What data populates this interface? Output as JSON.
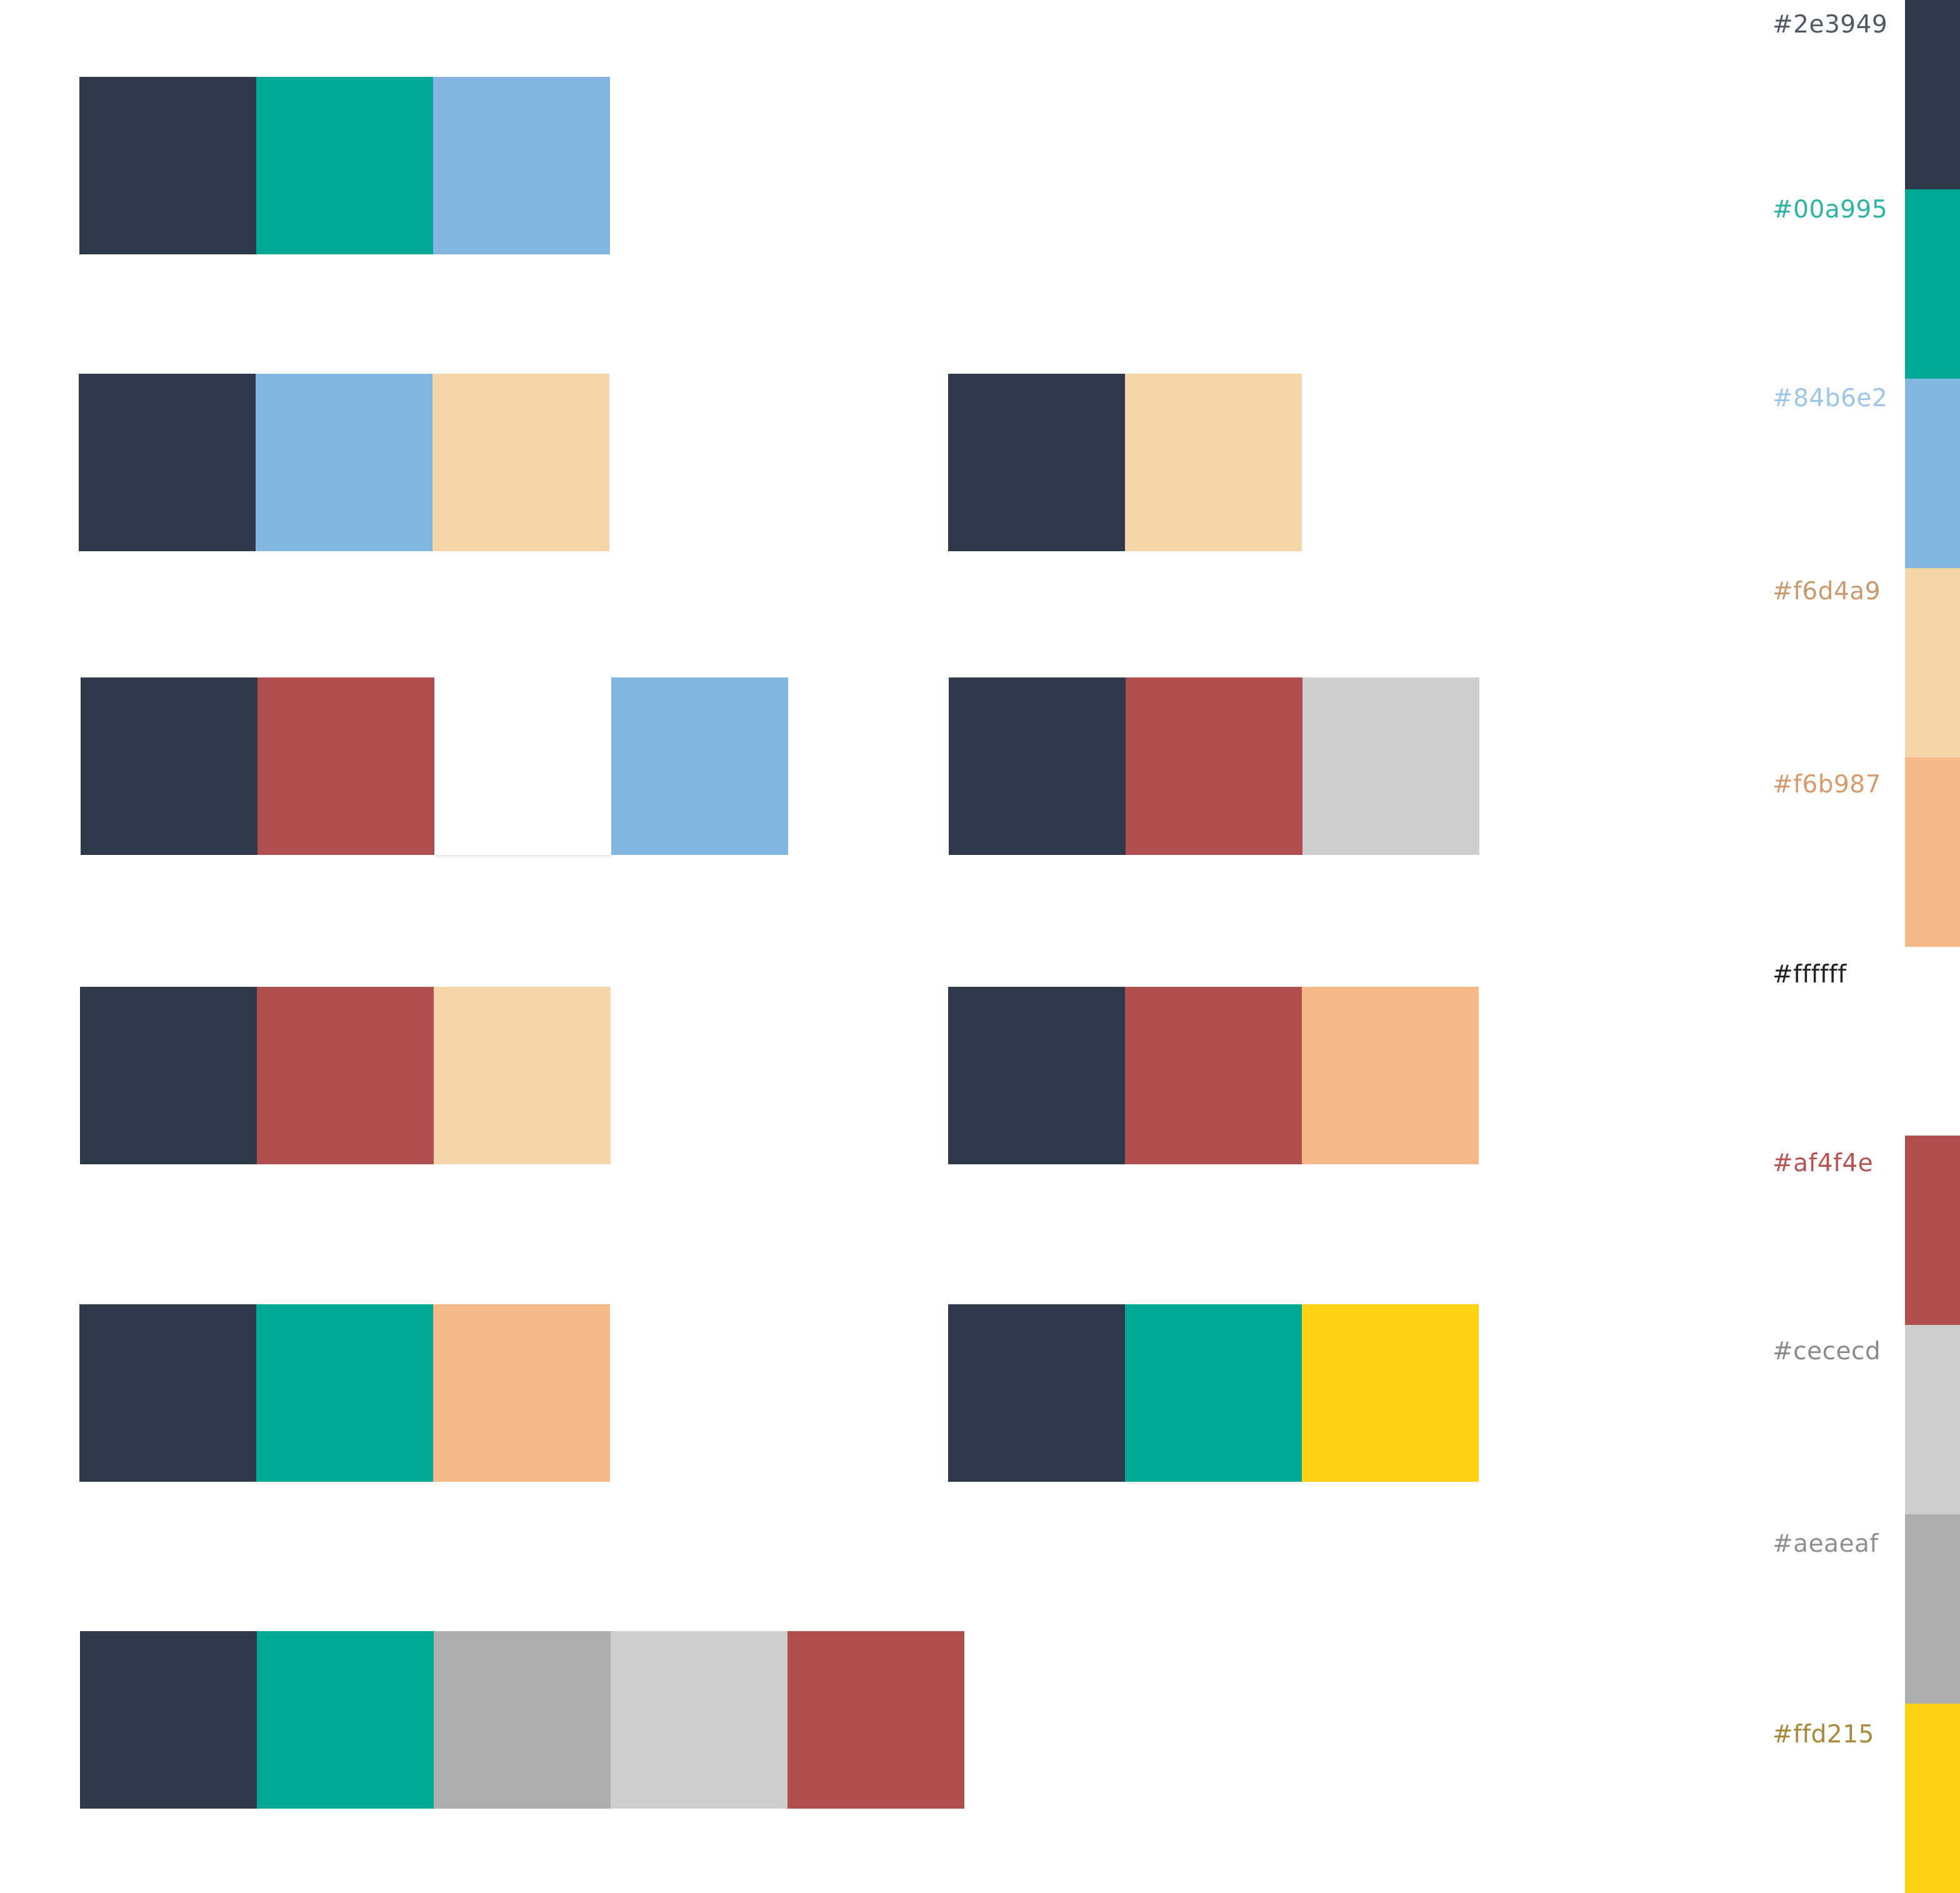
{
  "palette": [
    {
      "hex": "#2e3949",
      "label": "#2e3949",
      "label_color": "#505865"
    },
    {
      "hex": "#00a995",
      "label": "#00a995",
      "label_color": "#2db3a4"
    },
    {
      "hex": "#84b6e2",
      "label": "#84b6e2",
      "label_color": "#9cc5e8"
    },
    {
      "hex": "#f6d4a9",
      "label": "#f6d4a9",
      "label_color": "#c89b6e"
    },
    {
      "hex": "#f6b987",
      "label": "#f6b987",
      "label_color": "#d79b6b"
    },
    {
      "hex": "#ffffff",
      "label": "#ffffff",
      "label_color": "#222222"
    },
    {
      "hex": "#af4f4e",
      "label": "#af4f4e",
      "label_color": "#b65453"
    },
    {
      "hex": "#cececd",
      "label": "#cececd",
      "label_color": "#8a8a8a"
    },
    {
      "hex": "#aeaeaf",
      "label": "#aeaeaf",
      "label_color": "#8f8f90"
    },
    {
      "hex": "#ffd215",
      "label": "#ffd215",
      "label_color": "#a8893a"
    }
  ],
  "combinations": [
    {
      "colors": [
        "#2e3949",
        "#00a995",
        "#84b6e2"
      ]
    },
    {
      "colors": [
        "#2e3949",
        "#84b6e2",
        "#f6d4a9"
      ]
    },
    {
      "colors": [
        "#2e3949",
        "#f6d4a9"
      ]
    },
    {
      "colors": [
        "#2e3949",
        "#af4f4e",
        "#ffffff",
        "#84b6e2"
      ]
    },
    {
      "colors": [
        "#2e3949",
        "#af4f4e",
        "#cececd"
      ]
    },
    {
      "colors": [
        "#2e3949",
        "#af4f4e",
        "#f6d4a9"
      ]
    },
    {
      "colors": [
        "#2e3949",
        "#af4f4e",
        "#f6b987"
      ]
    },
    {
      "colors": [
        "#2e3949",
        "#00a995",
        "#f6b987"
      ]
    },
    {
      "colors": [
        "#2e3949",
        "#00a995",
        "#ffd215"
      ]
    },
    {
      "colors": [
        "#2e3949",
        "#00a995",
        "#aeaeaf",
        "#cececd",
        "#af4f4e"
      ]
    }
  ]
}
